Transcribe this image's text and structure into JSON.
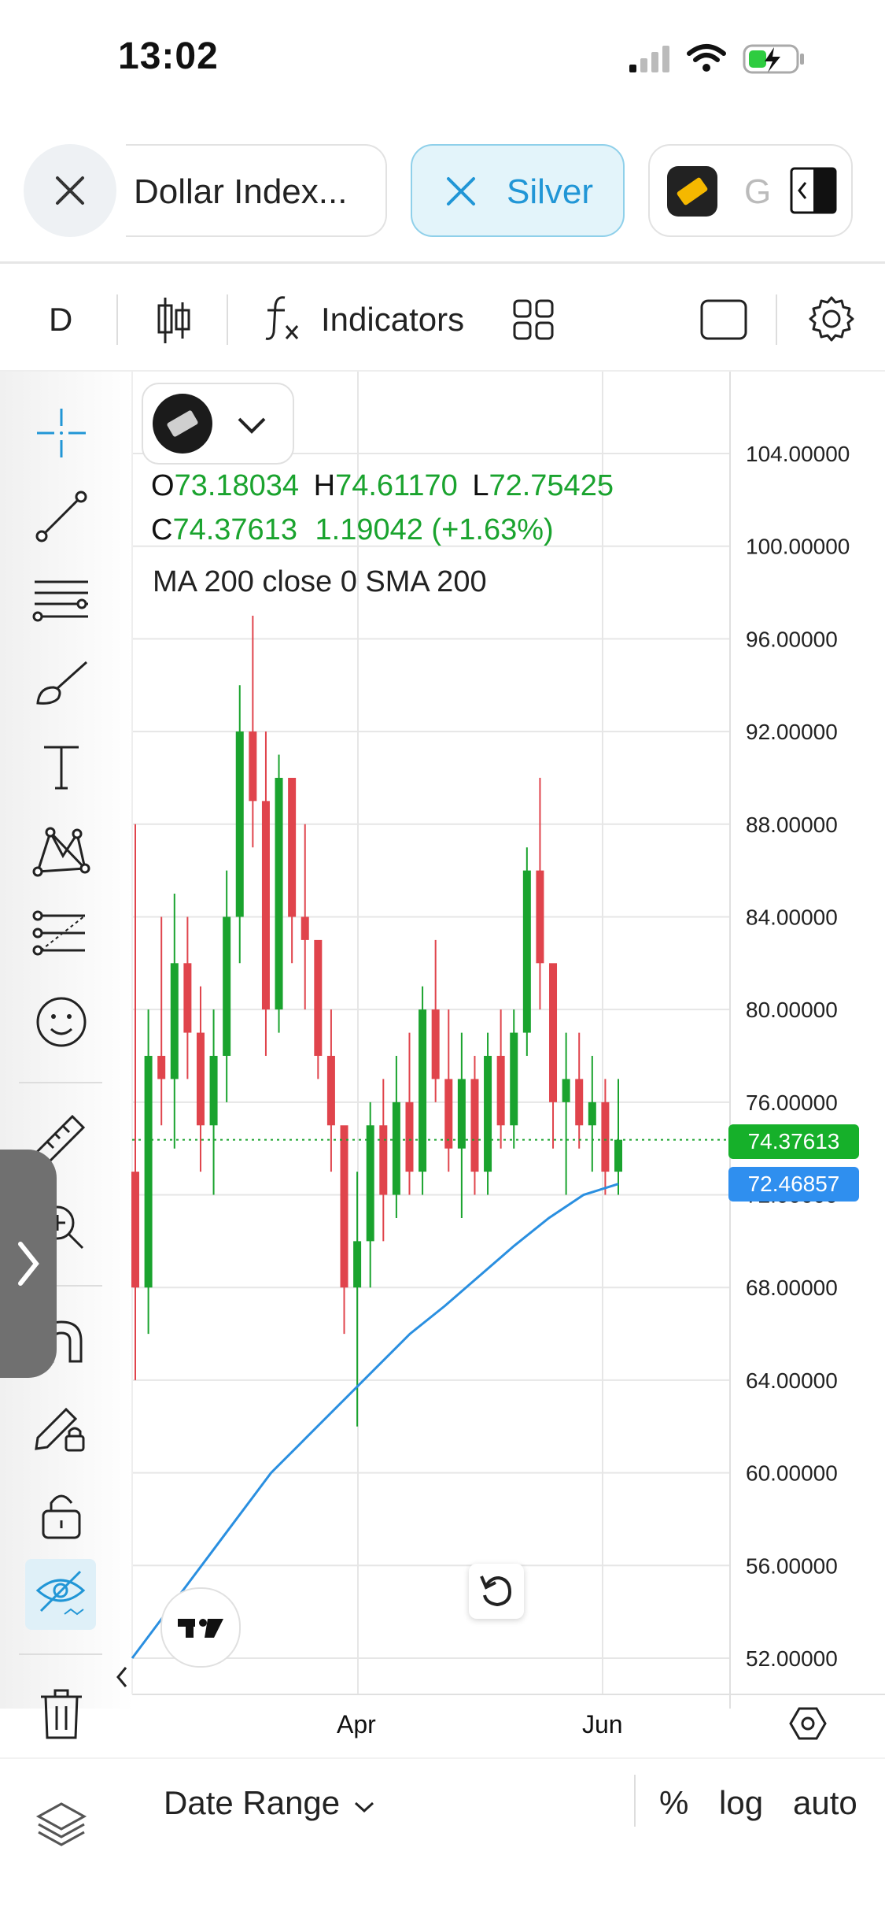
{
  "status_bar": {
    "time": "13:02"
  },
  "tabs": [
    {
      "label": "Dollar Index...",
      "active": false
    },
    {
      "label": "Silver",
      "active": true
    },
    {
      "label": "G",
      "active": false
    }
  ],
  "toolbar": {
    "interval": "D",
    "indicators_label": "Indicators"
  },
  "legend": {
    "open_prefix": "O",
    "open": "73.18034",
    "high_prefix": "H",
    "high": "74.61170",
    "low_prefix": "L",
    "low": "72.75425",
    "close_prefix": "C",
    "close": "74.37613",
    "change": "1.19042 (+1.63%)",
    "ma_label": "MA 200 close 0 SMA 200"
  },
  "price_axis": {
    "labels": [
      "104.00000",
      "100.00000",
      "96.00000",
      "92.00000",
      "88.00000",
      "84.00000",
      "80.00000",
      "76.00000",
      "72.00000",
      "68.00000",
      "64.00000",
      "60.00000",
      "56.00000",
      "52.00000"
    ],
    "last_price": "74.37613",
    "ma_price": "72.46857"
  },
  "time_axis": {
    "labels": [
      "Apr",
      "Jun"
    ]
  },
  "bottom_bar": {
    "date_range": "Date Range",
    "percent": "%",
    "log": "log",
    "auto": "auto"
  },
  "colors": {
    "up": "#1aa32e",
    "down": "#e0444c",
    "ma": "#2a8fe0",
    "accent": "#2196d6",
    "price_badge_up": "#16b02a",
    "price_badge_ma": "#2f8fef"
  },
  "chart_data": {
    "type": "candlestick",
    "ylim": [
      50,
      106
    ],
    "candles": [
      [
        73,
        88,
        64,
        68
      ],
      [
        68,
        80,
        66,
        78
      ],
      [
        78,
        84,
        75,
        77
      ],
      [
        77,
        85,
        74,
        82
      ],
      [
        82,
        84,
        77,
        79
      ],
      [
        79,
        81,
        73,
        75
      ],
      [
        75,
        80,
        72,
        78
      ],
      [
        78,
        86,
        76,
        84
      ],
      [
        84,
        94,
        82,
        92
      ],
      [
        92,
        97,
        87,
        89
      ],
      [
        89,
        92,
        78,
        80
      ],
      [
        80,
        91,
        79,
        90
      ],
      [
        90,
        89,
        82,
        84
      ],
      [
        84,
        88,
        80,
        83
      ],
      [
        83,
        82,
        77,
        78
      ],
      [
        78,
        80,
        73,
        75
      ],
      [
        75,
        72,
        66,
        68
      ],
      [
        68,
        73,
        62,
        70
      ],
      [
        70,
        76,
        68,
        75
      ],
      [
        75,
        77,
        70,
        72
      ],
      [
        72,
        78,
        71,
        76
      ],
      [
        76,
        79,
        72,
        73
      ],
      [
        73,
        81,
        72,
        80
      ],
      [
        80,
        83,
        76,
        77
      ],
      [
        77,
        80,
        73,
        74
      ],
      [
        74,
        79,
        71,
        77
      ],
      [
        77,
        78,
        72,
        73
      ],
      [
        73,
        79,
        72,
        78
      ],
      [
        78,
        80,
        74,
        75
      ],
      [
        75,
        80,
        74,
        79
      ],
      [
        79,
        87,
        78,
        86
      ],
      [
        86,
        90,
        80,
        82
      ],
      [
        82,
        81,
        74,
        76
      ],
      [
        76,
        79,
        72,
        77
      ],
      [
        77,
        79,
        74,
        75
      ],
      [
        75,
        78,
        73,
        76
      ],
      [
        76,
        77,
        72,
        73
      ],
      [
        73,
        77,
        72,
        74.37613
      ]
    ],
    "ma200": [
      52,
      54,
      56,
      58,
      60,
      61.5,
      63,
      64.5,
      66,
      67.2,
      68.5,
      69.8,
      71,
      72,
      72.47
    ],
    "last_price": 74.37613,
    "ma_value": 72.46857
  }
}
